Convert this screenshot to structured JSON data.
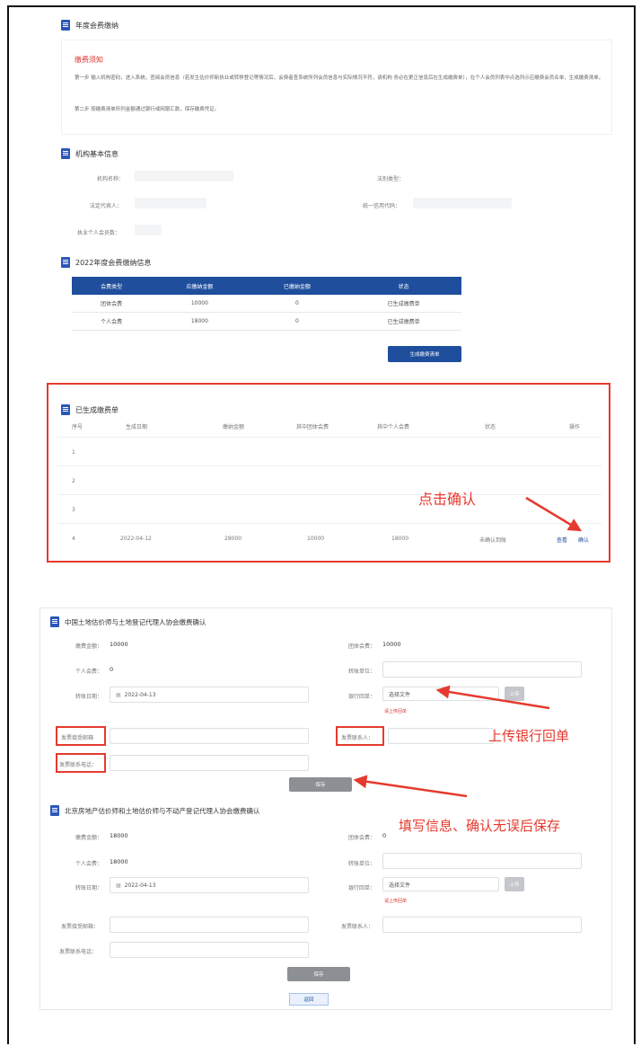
{
  "top": {
    "title": "年度会费缴纳",
    "notice_title": "缴费须知",
    "notice_line1": "第一步 输入机构密码，进入系统，查阅会员信息（若发生估价师新执业或转移登记等情况后，会费者查系统所列会员信息与实际情况不符，请机构 务必在更正信息后在生成缴费单），在个人会员列表中点选列示应缴费会员名单，生成缴费清单。",
    "notice_line2": "第二步 按缴费清单所列金额通过银行或网银汇款，保存缴费凭证。"
  },
  "org": {
    "title": "机构基本信息",
    "name_label": "机构名称：",
    "type_label": "法别类型：",
    "legal_label": "法定代表人：",
    "credit_label": "统一信用代码：",
    "members_label": "执业个人会员数："
  },
  "fee2022": {
    "title": "2022年度会费缴纳信息",
    "headers": [
      "会费类型",
      "应缴纳金额",
      "已缴纳金额",
      "状态"
    ],
    "rows": [
      [
        "团体会费",
        "10000",
        "0",
        "已生成缴费单"
      ],
      [
        "个人会费",
        "18000",
        "0",
        "已生成缴费单"
      ]
    ],
    "generate_button": "生成缴费清单"
  },
  "bills": {
    "title": "已生成缴费单",
    "headers": [
      "序号",
      "生成日期",
      "缴纳金额",
      "其中团体会费",
      "其中个人会费",
      "状态",
      "操作"
    ],
    "index_rows": [
      "1",
      "2",
      "3"
    ],
    "last_row": {
      "index": "4",
      "date": "2022-04-12",
      "amount": "28000",
      "group": "10000",
      "personal": "18000",
      "status": "未确认到账",
      "view": "查看",
      "confirm": "确认"
    },
    "annotation": "点击确认"
  },
  "confirm1": {
    "title": "中国土地估价师与土地登记代理人协会缴费确认",
    "total_label": "缴费金额：",
    "total_value": "10000",
    "group_label": "团体会费：",
    "group_value": "10000",
    "personal_label": "个人会费：",
    "personal_value": "0",
    "payer_label": "转账单位：",
    "date_label": "转账日期：",
    "date_value": "2022-04-13",
    "receipt_label": "银行回单：",
    "choose_file": "选择文件",
    "upload": "上传",
    "upload_note": "请上传回单",
    "invoice_email_label": "发票接受邮箱",
    "invoice_contact_label": "发票联系人：",
    "invoice_phone_label": "发票联系电话：",
    "save": "保存",
    "annotation_upload": "上传银行回单",
    "annotation_save": "填写信息、确认无误后保存"
  },
  "confirm2": {
    "title": "北京房地产估价师和土地估价师与不动产登记代理人协会缴费确认",
    "total_label": "缴费金额：",
    "total_value": "18000",
    "group_label": "团体会费：",
    "group_value": "0",
    "personal_label": "个人会费：",
    "personal_value": "18000",
    "payer_label": "转账单位：",
    "date_label": "转账日期：",
    "date_value": "2022-04-13",
    "receipt_label": "银行回单：",
    "choose_file": "选择文件",
    "upload": "上传",
    "upload_note": "请上传回单",
    "invoice_email_label": "发票接受邮箱：",
    "invoice_contact_label": "发票联系人：",
    "invoice_phone_label": "发票联系电话：",
    "save": "保存",
    "back": "返回"
  },
  "colors": {
    "accent": "#1f4e9c",
    "annotation": "#e53a2e"
  }
}
